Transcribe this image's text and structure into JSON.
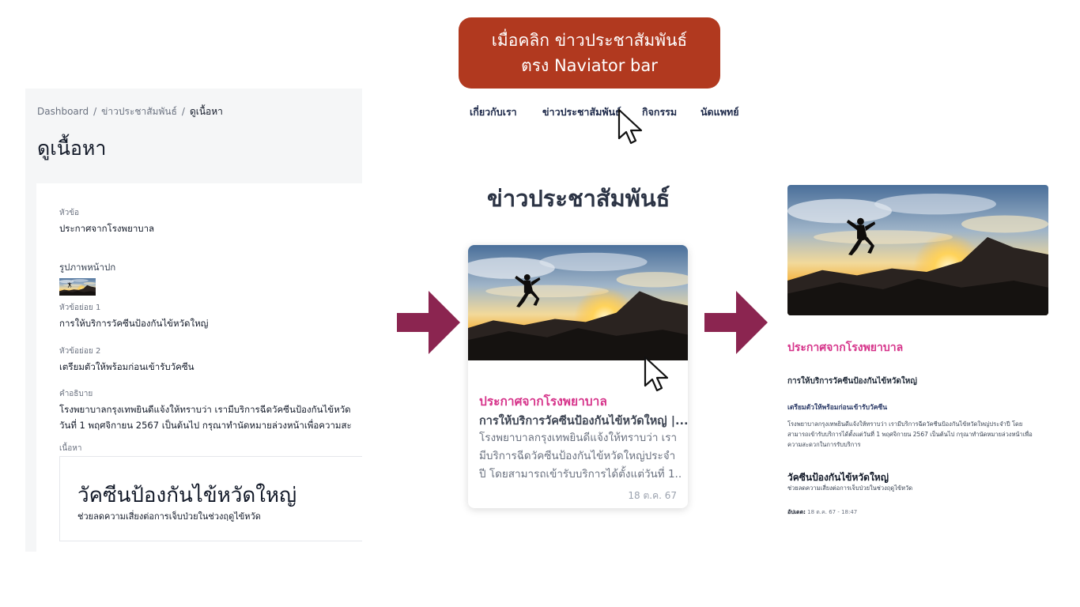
{
  "callout": {
    "line1": "เมื่อคลิก ข่าวประชาสัมพันธ์",
    "line2": "ตรง Naviator bar",
    "color": "#b1391f"
  },
  "admin": {
    "breadcrumb": {
      "dashboard": "Dashboard",
      "section": "ข่าวประชาสัมพันธ์",
      "current": "ดูเนื้อหา",
      "separator": "/"
    },
    "page_title": "ดูเนื้อหา",
    "fields": {
      "title_label": "หัวข้อ",
      "title_value": "ประกาศจากโรงพยาบาล",
      "cover_label": "รูปภาพหน้าปก",
      "subtitle1_label": "หัวข้อย่อย 1",
      "subtitle1_value": "การให้บริการวัคซีนป้องกันไข้หวัดใหญ่",
      "subtitle2_label": "หัวข้อย่อย 2",
      "subtitle2_value": "เตรียมตัวให้พร้อมก่อนเข้ารับวัคซีน",
      "desc_label": "คำอธิบาย",
      "desc_line1": "โรงพยาบาลกรุงเทพยินดีแจ้งให้ทราบว่า เรามีบริการฉีดวัคซีนป้องกันไข้หวัด",
      "desc_line2": "วันที่ 1 พฤศจิกายน 2567 เป็นต้นไป กรุณาทำนัดหมายล่วงหน้าเพื่อความสะ",
      "content_label": "เนื้อหา"
    },
    "content": {
      "heading": "วัคซีนป้องกันไข้หวัดใหญ่",
      "subtext": "ช่วยลดความเสี่ยงต่อการเจ็บป่วยในช่วงฤดูไข้หวัด"
    }
  },
  "nav": {
    "items": [
      "เกี่ยวกับเรา",
      "ข่าวประชาสัมพันธ์",
      "กิจกรรม",
      "นัดแพทย์"
    ],
    "color": "#1e2a4a"
  },
  "news": {
    "heading": "ข่าวประชาสัมพันธ์",
    "card": {
      "title": "ประกาศจากโรงพยาบาล",
      "subtitle": "การให้บริการวัคซีนป้องกันไข้หวัดใหญ่ |...",
      "desc_line1": "โรงพยาบาลกรุงเทพยินดีแจ้งให้ทราบว่า เรา",
      "desc_line2": "มีบริการฉีดวัคซีนป้องกันไข้หวัดใหญ่ประจำ",
      "desc_line3": "ปี โดยสามารถเข้ารับบริการได้ตั้งแต่วันที่ 1...",
      "date": "18 ต.ค. 67"
    },
    "accent": "#d6338a"
  },
  "detail": {
    "title": "ประกาศจากโรงพยาบาล",
    "subtitle1": "การให้บริการวัคซีนป้องกันไข้หวัดใหญ่",
    "subtitle2": "เตรียมตัวให้พร้อมก่อนเข้ารับวัคซีน",
    "desc_line1": "โรงพยาบาลกรุงเทพยินดีแจ้งให้ทราบว่า เรามีบริการฉีดวัคซีนป้องกันไข้หวัดใหญ่ประจำปี โดย",
    "desc_line2": "สามารถเข้ารับบริการได้ตั้งแต่วันที่ 1 พฤศจิกายน 2567 เป็นต้นไป กรุณาทำนัดหมายล่วงหน้าเพื่อ",
    "desc_line3": "ความสะดวกในการรับบริการ",
    "content_heading": "วัคซีนป้องกันไข้หวัดใหญ่",
    "content_sub": "ช่วยลดความเสี่ยงต่อการเจ็บป่วยในช่วงฤดูไข้หวัด",
    "updated_label": "อัปเดต:",
    "updated_value": "18 ต.ค. 67 - 18:47"
  },
  "icons": {
    "arrow": "arrow-right-icon",
    "cursor": "mouse-pointer-icon",
    "image": "sunset-jumper-image"
  },
  "arrow_color": "#8b2550"
}
